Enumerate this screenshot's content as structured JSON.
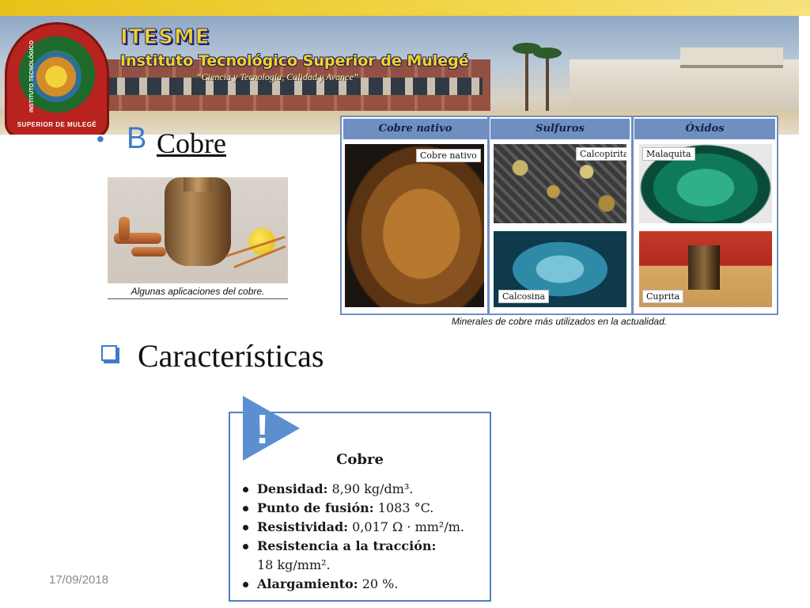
{
  "header": {
    "acronym": "ITESME",
    "institution": "Instituto Tecnológico Superior de Mulegé",
    "motto": "“Ciencia y Tecnología, Calidad y Avance”",
    "logo_text_bottom": "SUPERIOR DE MULEGÉ",
    "logo_text_side": "INSTITUTO TECNOLÓGICO",
    "band_color": "#e8c21a"
  },
  "title": {
    "bullet": "•",
    "letter": "B",
    "word": "Cobre",
    "accent_color": "#3b7dc8"
  },
  "applications": {
    "caption": "Algunas aplicaciones del cobre."
  },
  "minerals": {
    "columns": [
      "Cobre nativo",
      "Sulfuros",
      "Óxidos"
    ],
    "labels": {
      "nativo": "Cobre nativo",
      "calcopirita": "Calcopirita",
      "calcosina": "Calcosina",
      "malaquita": "Malaquita",
      "cuprita": "Cuprita"
    },
    "caption": "Minerales de cobre más utilizados en la actualidad.",
    "frame_color": "#6f8fc0"
  },
  "characteristics": {
    "heading": "Características"
  },
  "card": {
    "icon_glyph": "!",
    "title": "Cobre",
    "items": [
      {
        "label": "Densidad:",
        "value": "8,90 kg/dm³."
      },
      {
        "label": "Punto de fusión:",
        "value": "1083 °C."
      },
      {
        "label": "Resistividad:",
        "value": "0,017 Ω · mm²/m."
      },
      {
        "label": "Resistencia a la tracción:",
        "value": "18 kg/mm²."
      },
      {
        "label": "Alargamiento:",
        "value": "20 %."
      }
    ],
    "border_color": "#4d80c2"
  },
  "footer": {
    "date": "17/09/2018"
  }
}
